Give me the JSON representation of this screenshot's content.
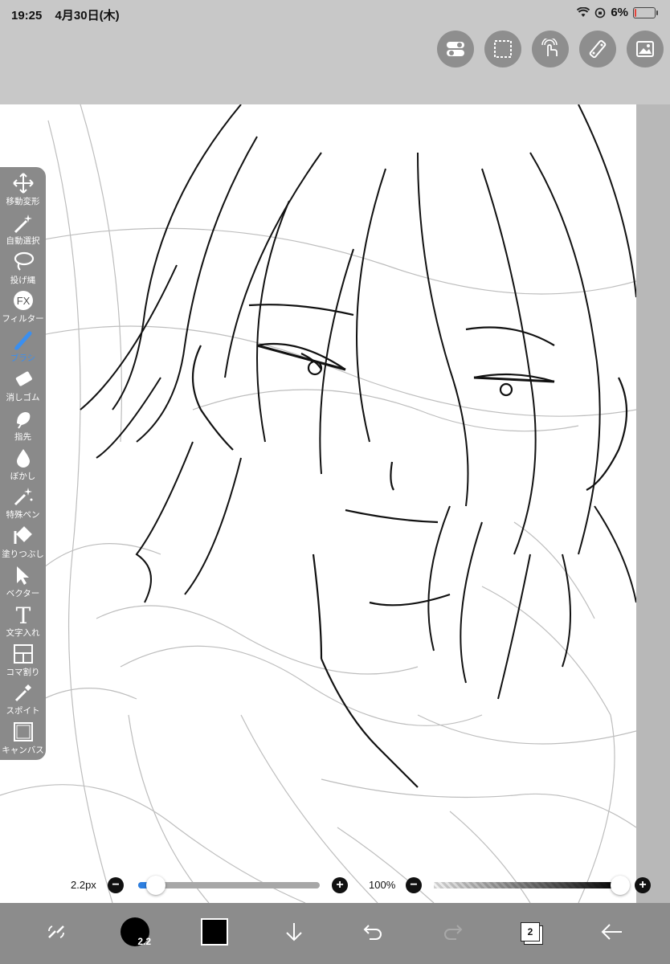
{
  "status_bar": {
    "time": "19:25",
    "date": "4月30日(木)",
    "battery_percent": "6%",
    "battery_level": 0.06,
    "battery_color": "#e5433a"
  },
  "top_buttons": [
    {
      "name": "toggle-icon"
    },
    {
      "name": "selection-icon"
    },
    {
      "name": "gesture-icon"
    },
    {
      "name": "ruler-icon"
    },
    {
      "name": "material-icon"
    }
  ],
  "toolbar": {
    "active_color": "#3a8ff0",
    "items": [
      {
        "label": "移動変形",
        "icon": "move-icon"
      },
      {
        "label": "自動選択",
        "icon": "magic-wand-icon"
      },
      {
        "label": "投げ縄",
        "icon": "lasso-icon"
      },
      {
        "label": "フィルター",
        "icon": "fx-icon"
      },
      {
        "label": "ブラシ",
        "icon": "brush-icon"
      },
      {
        "label": "消しゴム",
        "icon": "eraser-icon"
      },
      {
        "label": "指先",
        "icon": "smudge-icon"
      },
      {
        "label": "ぼかし",
        "icon": "blur-icon"
      },
      {
        "label": "特殊ペン",
        "icon": "special-pen-icon"
      },
      {
        "label": "塗りつぶし",
        "icon": "fill-icon"
      },
      {
        "label": "ベクター",
        "icon": "vector-icon"
      },
      {
        "label": "文字入れ",
        "icon": "text-icon"
      },
      {
        "label": "コマ割り",
        "icon": "frame-divider-icon"
      },
      {
        "label": "スポイト",
        "icon": "eyedropper-icon"
      },
      {
        "label": "キャンバス",
        "icon": "canvas-icon"
      }
    ]
  },
  "brush_size": {
    "label": "2.2px",
    "level": 0.06
  },
  "opacity": {
    "label": "100%",
    "level": 1.0
  },
  "bottom_bar": {
    "brush_size_badge": "2.2",
    "layer_count": "2",
    "color": "#000000"
  },
  "artwork": {
    "description_hidden": true
  }
}
